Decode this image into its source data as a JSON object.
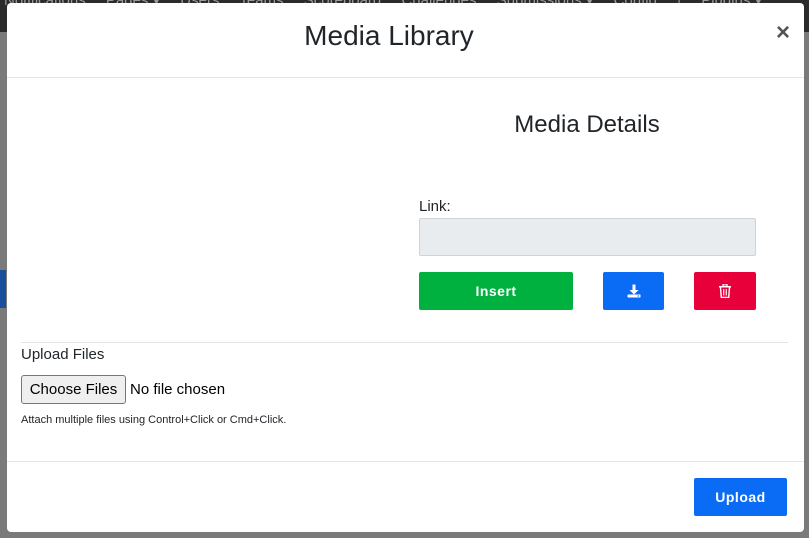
{
  "background": {
    "nav_items": [
      "Notifications",
      "Pages ▾",
      "Users",
      "Teams",
      "Scoreboard",
      "Challenges",
      "Submissions ▾",
      "Config",
      "|",
      "Plugins ▾"
    ]
  },
  "modal": {
    "title": "Media Library",
    "close_label": "×",
    "details_title": "Media Details",
    "link_label": "Link:",
    "link_value": "",
    "insert_label": "Insert",
    "upload_files_label": "Upload Files",
    "choose_files_label": "Choose Files",
    "no_file_text": "No file chosen",
    "hint_text": "Attach multiple files using Control+Click or Cmd+Click.",
    "upload_label": "Upload"
  },
  "icons": {
    "download": "download-icon",
    "delete": "trash-icon",
    "close": "close-icon"
  },
  "colors": {
    "insert": "#00b140",
    "primary": "#0a6cf5",
    "danger": "#e8003a"
  }
}
